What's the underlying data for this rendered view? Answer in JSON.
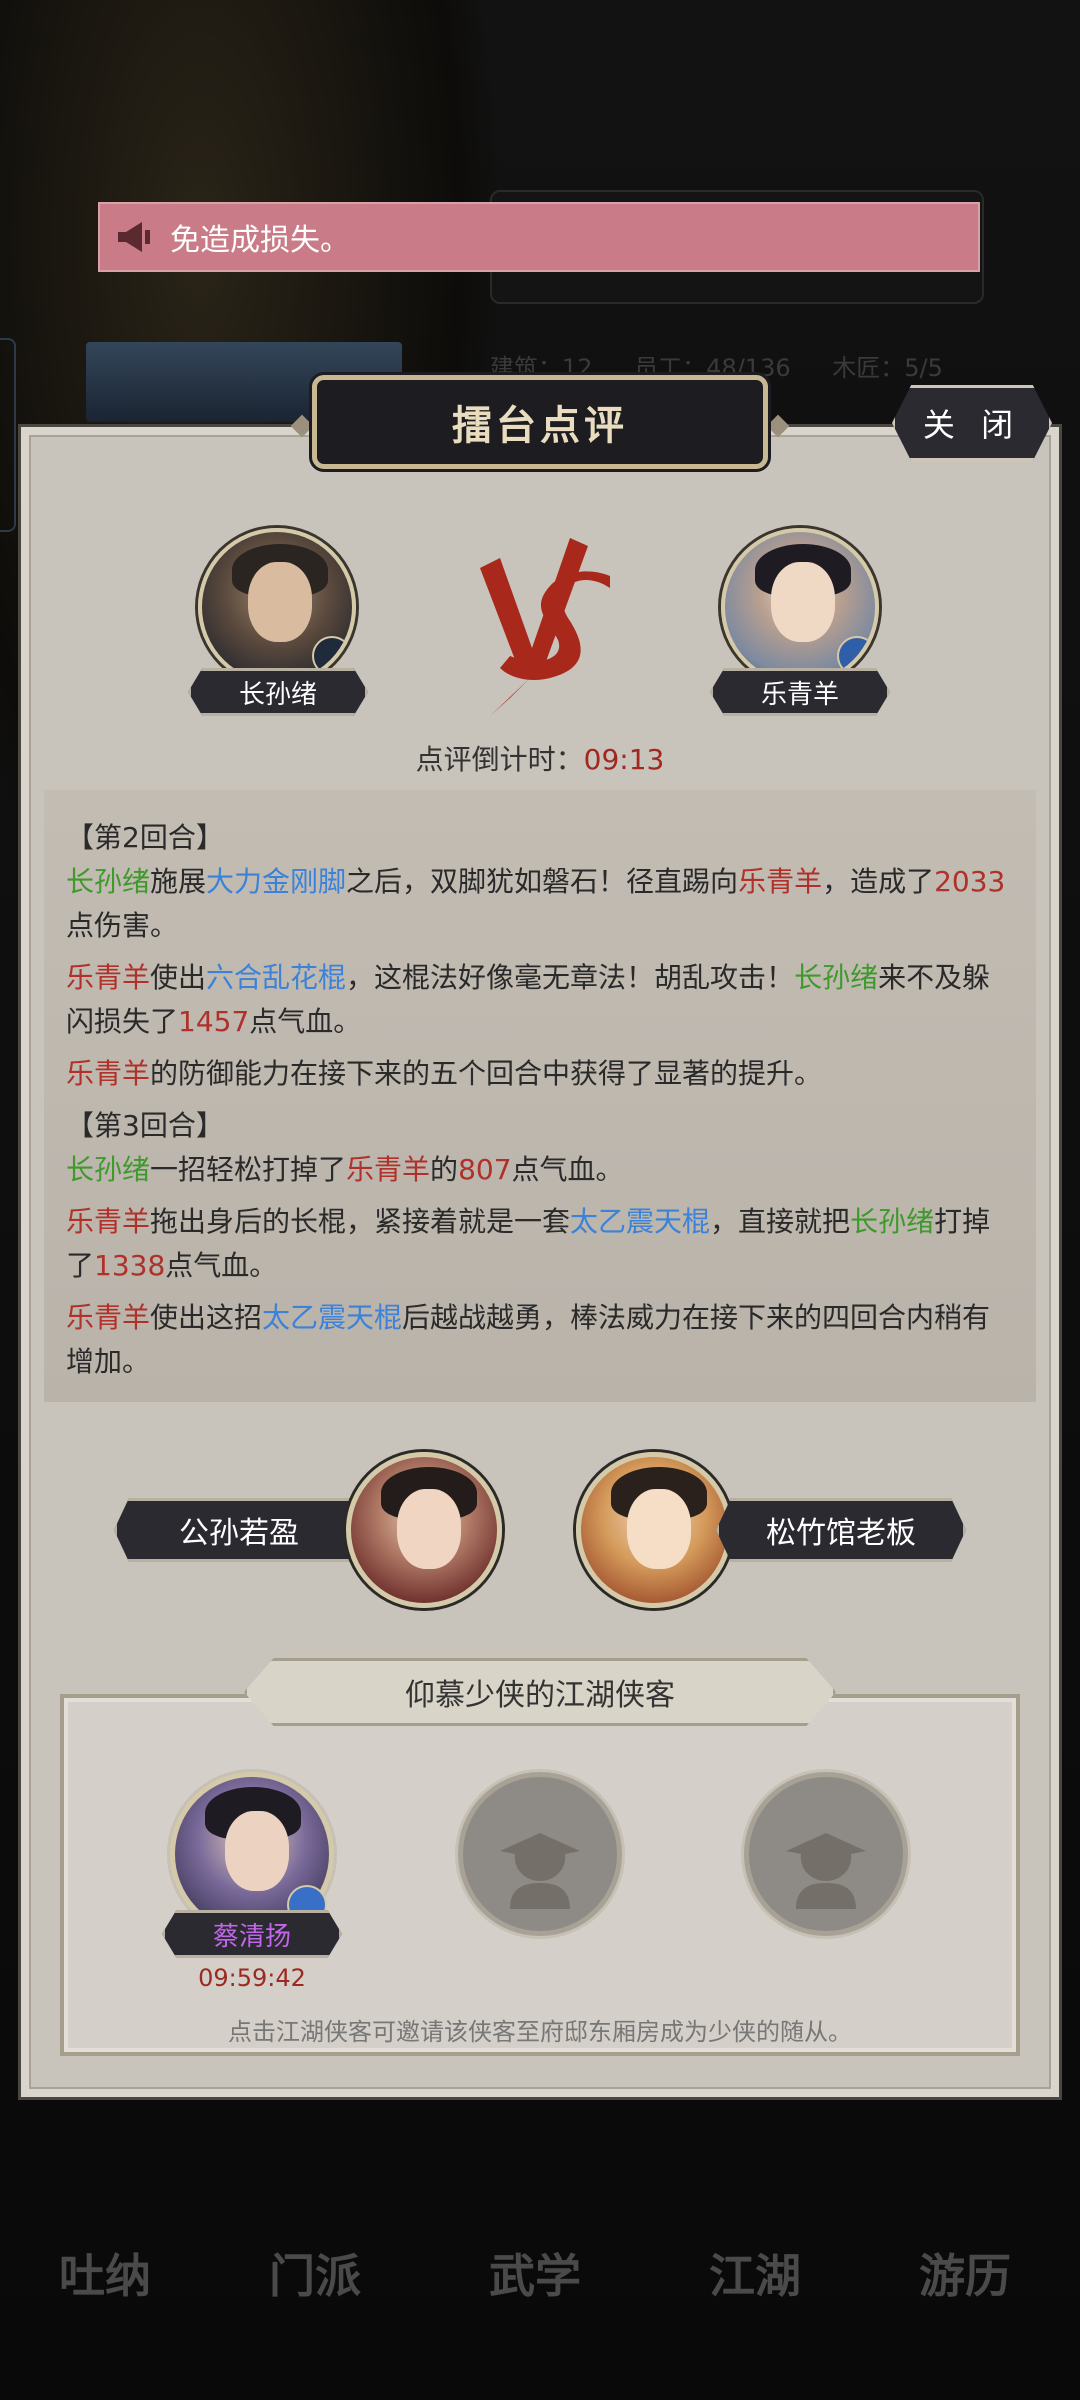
{
  "notice": {
    "text": "免造成损失。"
  },
  "background": {
    "stats": [
      "建筑：12",
      "员工：48/136",
      "木匠：5/5"
    ]
  },
  "dialog": {
    "title": "擂台点评",
    "close_label": "关 闭",
    "fighter_left": {
      "name": "长孙绪"
    },
    "fighter_right": {
      "name": "乐青羊"
    },
    "vs_label": "VS",
    "countdown_label": "点评倒计时：",
    "countdown_value": "09:13"
  },
  "log": {
    "round2_title": "【第2回合】",
    "r2": {
      "l1": {
        "a": "长孙绪",
        "b": "施展",
        "c": "大力金刚脚",
        "d": "之后，双脚犹如磐石！径直踢向",
        "e": "乐青羊",
        "f": "，造成了",
        "g": "2033",
        "h": "点伤害。"
      },
      "l2": {
        "a": "乐青羊",
        "b": "使出",
        "c": "六合乱花棍",
        "d": "，这棍法好像毫无章法！胡乱攻击！",
        "e": "长孙绪",
        "f": "来不及躲闪损失了",
        "g": "1457",
        "h": "点气血。"
      },
      "l3": {
        "a": "乐青羊",
        "b": "的防御能力在接下来的五个回合中获得了显著的提升。"
      }
    },
    "round3_title": "【第3回合】",
    "r3": {
      "l1": {
        "a": "长孙绪",
        "b": "一招轻松打掉了",
        "c": "乐青羊",
        "d": "的",
        "e": "807",
        "f": "点气血。"
      },
      "l2": {
        "a": "乐青羊",
        "b": "拖出身后的长棍，紧接着就是一套",
        "c": "太乙震天棍",
        "d": "，直接就把",
        "e": "长孙绪",
        "f": "打掉了",
        "g": "1338",
        "h": "点气血。"
      },
      "l3": {
        "a": "乐青羊",
        "b": "使出这招",
        "c": "太乙震天棍",
        "d": "后越战越勇，棒法威力在接下来的四回合内稍有增加。"
      }
    }
  },
  "npcs": [
    {
      "name": "公孙若盈"
    },
    {
      "name": "松竹馆老板"
    }
  ],
  "fans": {
    "title": "仰慕少侠的江湖侠客",
    "first": {
      "name": "蔡清扬",
      "timer": "09:59:42"
    },
    "hint": "点击江湖侠客可邀请该侠客至府邸东厢房成为少侠的随从。"
  },
  "bottom_nav": [
    "吐纳",
    "门派",
    "武学",
    "江湖",
    "游历"
  ],
  "colors": {
    "hero": "#3e9a2a",
    "enemy": "#b0302a",
    "skill": "#3b82d8",
    "number": "#b0302a",
    "notice_bg": "#c97c87"
  },
  "icons": [
    "megaphone-icon",
    "vs-emblem",
    "rank-badge-icon",
    "silhouette-icon"
  ]
}
